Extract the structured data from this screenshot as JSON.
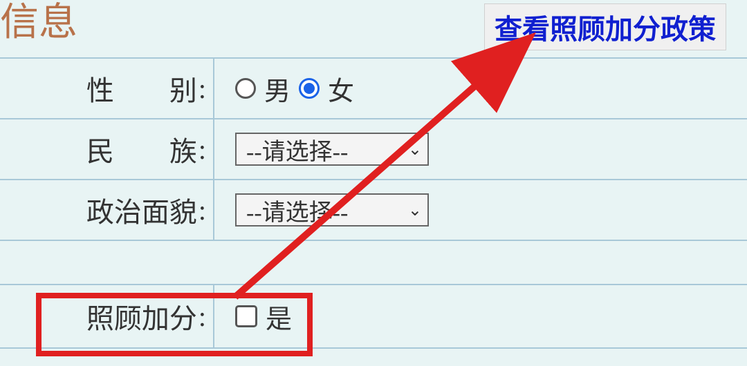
{
  "section_title": "信息",
  "policy_link_label": "查看照顾加分政策",
  "rows": {
    "gender": {
      "label": "性　　别",
      "colon": ":",
      "options": {
        "male": "男",
        "female": "女"
      },
      "selected": "female"
    },
    "ethnicity": {
      "label": "民　　族",
      "colon": ":",
      "placeholder": "--请选择--"
    },
    "political": {
      "label": "政治面貌",
      "colon": ":",
      "placeholder": "--请选择--"
    },
    "bonus": {
      "label": "照顾加分",
      "colon": ":",
      "option_yes": "是"
    }
  }
}
